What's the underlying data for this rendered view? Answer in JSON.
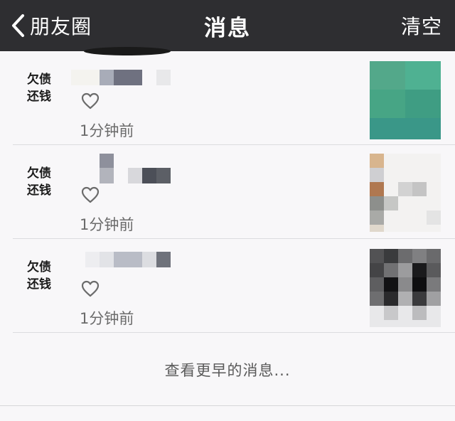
{
  "navbar": {
    "back_label": "朋友圈",
    "title": "消息",
    "clear_label": "清空"
  },
  "messages": [
    {
      "avatar_line1": "欠债",
      "avatar_line2": "还钱",
      "time": "1分钟前"
    },
    {
      "avatar_line1": "欠债",
      "avatar_line2": "还钱",
      "time": "1分钟前"
    },
    {
      "avatar_line1": "欠债",
      "avatar_line2": "还钱",
      "time": "1分钟前"
    }
  ],
  "load_more": "查看更早的消息...",
  "colors": {
    "navbar_bg": "#2e2e31",
    "page_bg": "#f8f7f9",
    "thumb1": "#4aa98a"
  },
  "icons": [
    "chevron-left-icon",
    "heart-outline-icon"
  ]
}
